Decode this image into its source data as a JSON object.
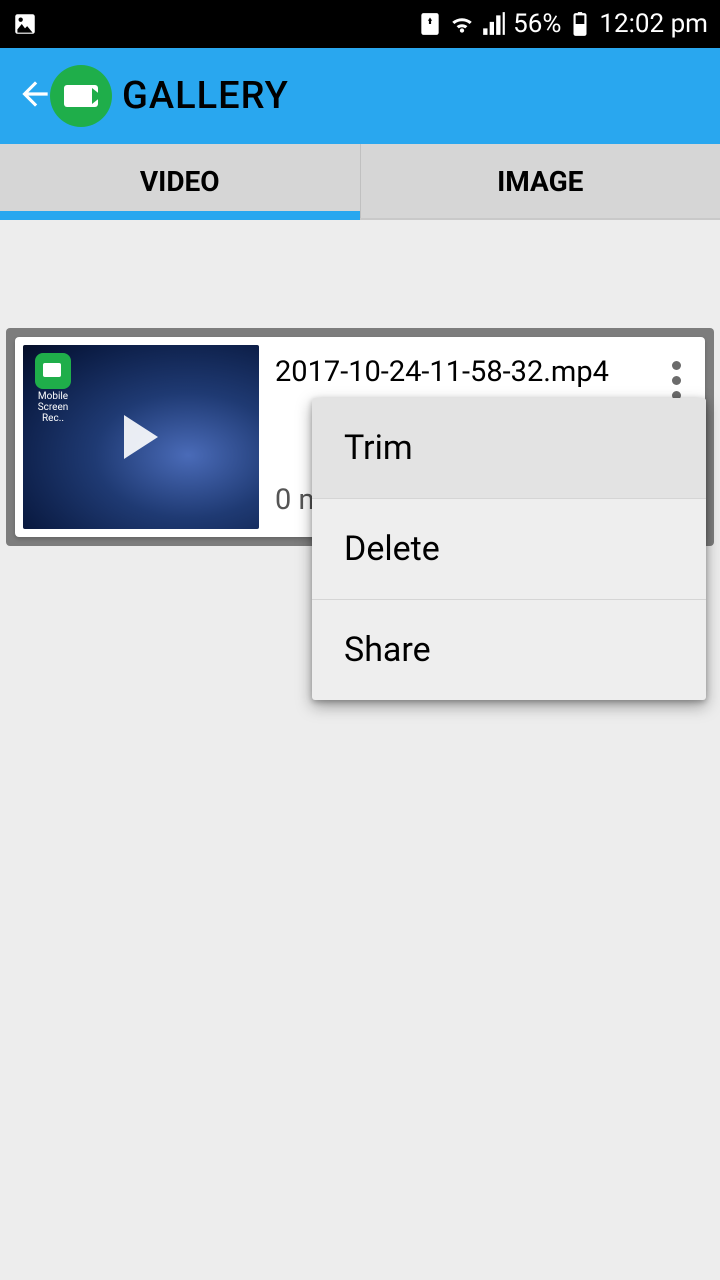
{
  "status": {
    "battery_pct": "56%",
    "time": "12:02 pm"
  },
  "app": {
    "title": "GALLERY"
  },
  "tabs": [
    {
      "label": "VIDEO",
      "active": true
    },
    {
      "label": "IMAGE",
      "active": false
    }
  ],
  "items": [
    {
      "filename": "2017-10-24-11-58-32.mp4",
      "meta": "0 m",
      "thumb_app_label": "Mobile Screen Rec.."
    }
  ],
  "popup": {
    "items": [
      {
        "label": "Trim"
      },
      {
        "label": "Delete"
      },
      {
        "label": "Share"
      }
    ]
  }
}
